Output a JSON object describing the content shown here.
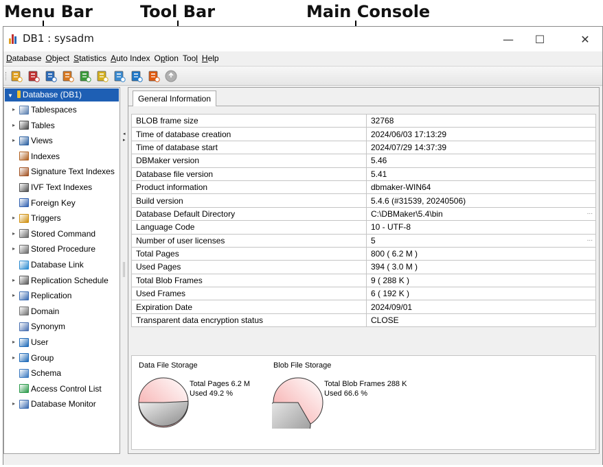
{
  "callouts": {
    "menu_bar": "Menu Bar",
    "tool_bar": "Tool Bar",
    "main_console": "Main Console"
  },
  "window": {
    "title": "DB1 : sysadm",
    "minimize_glyph": "—",
    "maximize_glyph": "☐",
    "close_glyph": "✕"
  },
  "menu": [
    {
      "label": "Database",
      "mnemonic": "D"
    },
    {
      "label": "Object",
      "mnemonic": "O"
    },
    {
      "label": "Statistics",
      "mnemonic": "S"
    },
    {
      "label": "Auto Index",
      "mnemonic": "A"
    },
    {
      "label": "Option",
      "mnemonic": "p"
    },
    {
      "label": "Tool",
      "mnemonic": "l"
    },
    {
      "label": "Help",
      "mnemonic": "H"
    }
  ],
  "toolbar_icons": [
    {
      "name": "start-database-icon",
      "color": "#e0a020"
    },
    {
      "name": "stop-database-icon",
      "color": "#c03030"
    },
    {
      "name": "table-wizard-icon",
      "color": "#2a6ab8"
    },
    {
      "name": "edit-icon",
      "color": "#d87820"
    },
    {
      "name": "load-icon",
      "color": "#3a9a3a"
    },
    {
      "name": "refresh-icon",
      "color": "#d4b020"
    },
    {
      "name": "settings-icon",
      "color": "#3a8ad0"
    },
    {
      "name": "query-icon",
      "color": "#1f78c8"
    },
    {
      "name": "lock-database-icon",
      "color": "#e05a10"
    },
    {
      "name": "disabled-icon",
      "color": "#b0b0b0"
    }
  ],
  "tree": {
    "root": "Database (DB1)",
    "items": [
      {
        "label": "Tablespaces",
        "expandable": true,
        "icon": "tablespaces-icon",
        "color": "#5a7fb0"
      },
      {
        "label": "Tables",
        "expandable": true,
        "icon": "tables-icon",
        "color": "#4a4a4a"
      },
      {
        "label": "Views",
        "expandable": true,
        "icon": "views-icon",
        "color": "#2a5fa0"
      },
      {
        "label": "Indexes",
        "expandable": false,
        "icon": "indexes-icon",
        "color": "#b06020"
      },
      {
        "label": "Signature Text Indexes",
        "expandable": false,
        "icon": "signature-text-index-icon",
        "color": "#a05020"
      },
      {
        "label": "IVF Text Indexes",
        "expandable": false,
        "icon": "ivf-text-index-icon",
        "color": "#505050"
      },
      {
        "label": "Foreign Key",
        "expandable": false,
        "icon": "foreign-key-icon",
        "color": "#3060b0"
      },
      {
        "label": "Triggers",
        "expandable": true,
        "icon": "triggers-icon",
        "color": "#d09010"
      },
      {
        "label": "Stored Command",
        "expandable": true,
        "icon": "stored-command-icon",
        "color": "#6a6a6a"
      },
      {
        "label": "Stored Procedure",
        "expandable": true,
        "icon": "stored-procedure-icon",
        "color": "#6a6a6a"
      },
      {
        "label": "Database Link",
        "expandable": false,
        "icon": "database-link-icon",
        "color": "#2a8ad0"
      },
      {
        "label": "Replication Schedule",
        "expandable": true,
        "icon": "replication-schedule-icon",
        "color": "#5a5a5a"
      },
      {
        "label": "Replication",
        "expandable": true,
        "icon": "replication-icon",
        "color": "#3a6ab0"
      },
      {
        "label": "Domain",
        "expandable": false,
        "icon": "domain-icon",
        "color": "#707070"
      },
      {
        "label": "Synonym",
        "expandable": false,
        "icon": "synonym-icon",
        "color": "#4a70b0"
      },
      {
        "label": "User",
        "expandable": true,
        "icon": "user-icon",
        "color": "#1e6ab8"
      },
      {
        "label": "Group",
        "expandable": true,
        "icon": "group-icon",
        "color": "#1e6ab8"
      },
      {
        "label": "Schema",
        "expandable": false,
        "icon": "schema-icon",
        "color": "#3a78c0"
      },
      {
        "label": "Access Control List",
        "expandable": false,
        "icon": "access-control-list-icon",
        "color": "#2a9a4a"
      },
      {
        "label": "Database Monitor",
        "expandable": true,
        "icon": "database-monitor-icon",
        "color": "#3a6ab0"
      }
    ]
  },
  "console": {
    "tab": "General Information",
    "rows": [
      {
        "label": "BLOB frame size",
        "value": "32768",
        "more": false
      },
      {
        "label": "Time of database creation",
        "value": "2024/06/03 17:13:29",
        "more": false
      },
      {
        "label": "Time of database start",
        "value": "2024/07/29 14:37:39",
        "more": false
      },
      {
        "label": "DBMaker version",
        "value": "5.46",
        "more": false
      },
      {
        "label": "Database file version",
        "value": "5.41",
        "more": false
      },
      {
        "label": "Product information",
        "value": "dbmaker-WIN64",
        "more": false
      },
      {
        "label": "Build version",
        "value": "5.4.6 (#31539, 20240506)",
        "more": false
      },
      {
        "label": "Database Default Directory",
        "value": "C:\\DBMaker\\5.4\\bin",
        "more": true
      },
      {
        "label": "Language Code",
        "value": "10 - UTF-8",
        "more": false
      },
      {
        "label": "Number of user licenses",
        "value": "5",
        "more": true
      },
      {
        "label": "Total Pages",
        "value": "800 ( 6.2 M )",
        "more": false
      },
      {
        "label": "Used Pages",
        "value": "394 ( 3.0 M )",
        "more": false
      },
      {
        "label": "Total Blob Frames",
        "value": "9 ( 288 K )",
        "more": false
      },
      {
        "label": "Used Frames",
        "value": "6 ( 192 K )",
        "more": false
      },
      {
        "label": "Expiration Date",
        "value": "2024/09/01",
        "more": false
      },
      {
        "label": "Transparent data encryption status",
        "value": "CLOSE",
        "more": false
      }
    ],
    "more_glyph": "..."
  },
  "storage": {
    "data": {
      "title": "Data File Storage",
      "total_text": "Total Pages 6.2 M",
      "used_text": "Used 49.2 %",
      "used_fraction": 0.492
    },
    "blob": {
      "title": "Blob File Storage",
      "total_text": "Total Blob Frames 288 K",
      "used_text": "Used 66.6 %",
      "used_fraction": 0.666
    }
  }
}
